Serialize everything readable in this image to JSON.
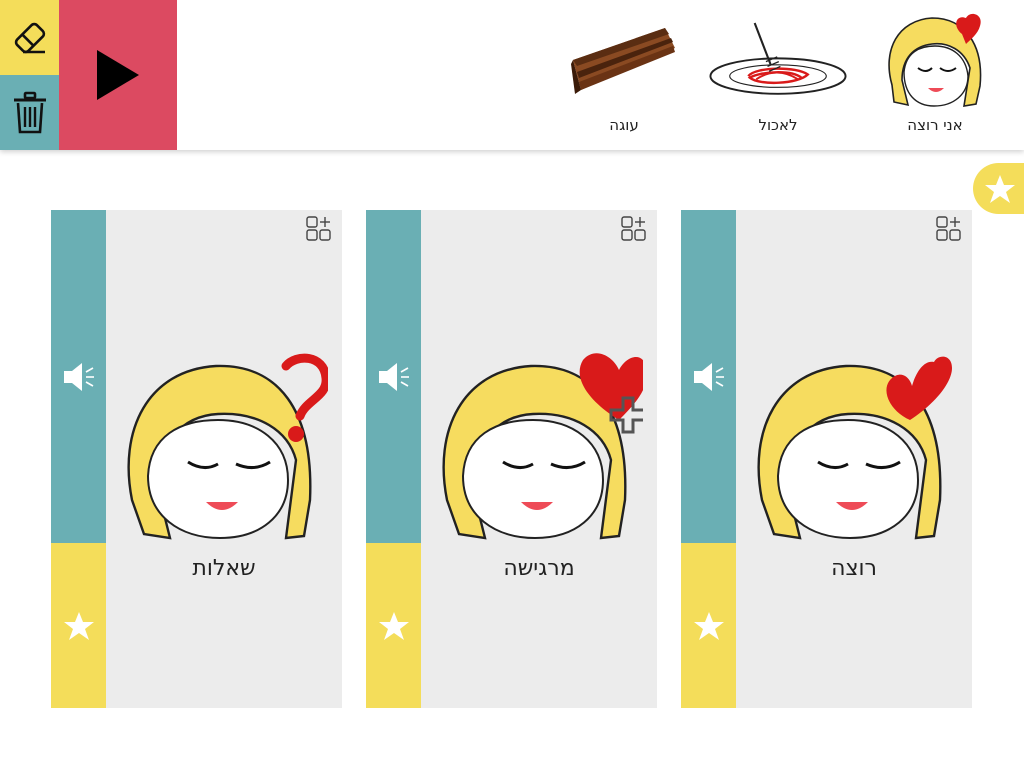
{
  "toolbar": {
    "eraser_icon": "eraser-icon",
    "trash_icon": "trash-icon",
    "play_icon": "play-icon",
    "colors": {
      "yellow": "#f4dd5a",
      "teal": "#6aafb4",
      "red": "#dc4a61"
    }
  },
  "sentence": {
    "items": [
      {
        "label": "אני רוצה",
        "icon": "girl-heart-icon"
      },
      {
        "label": "לאכול",
        "icon": "spaghetti-plate-icon"
      },
      {
        "label": "עוגה",
        "icon": "chocolate-cake-icon"
      }
    ]
  },
  "favorites_tab": {
    "icon": "star-icon"
  },
  "cards": [
    {
      "label": "רוצה",
      "icon": "girl-heart-icon"
    },
    {
      "label": "מרגישה",
      "icon": "girl-heart-plus-icon"
    },
    {
      "label": "שאלות",
      "icon": "girl-question-icon"
    }
  ]
}
